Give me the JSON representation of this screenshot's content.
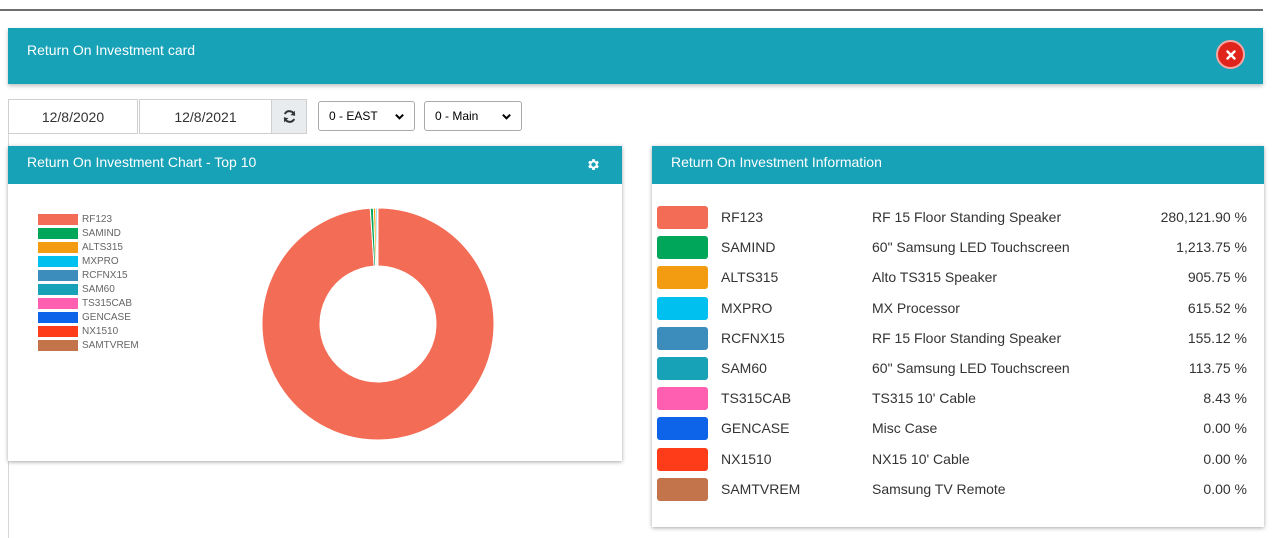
{
  "header": {
    "title": "Return On Investment card"
  },
  "filters": {
    "start_date": "12/8/2020",
    "end_date": "12/8/2021",
    "region": "0 - EAST",
    "location": "0 - Main"
  },
  "chart_card": {
    "title": "Return On Investment Chart - Top 10"
  },
  "info_card": {
    "title": "Return On Investment Information"
  },
  "items": [
    {
      "code": "RF123",
      "description": "RF 15 Floor Standing Speaker",
      "roi": "280,121.90 %",
      "color": "#f36c55"
    },
    {
      "code": "SAMIND",
      "description": "60\" Samsung LED Touchscreen",
      "roi": "1,213.75 %",
      "color": "#00a65a"
    },
    {
      "code": "ALTS315",
      "description": "Alto TS315 Speaker",
      "roi": "905.75 %",
      "color": "#f39c12"
    },
    {
      "code": "MXPRO",
      "description": "MX Processor",
      "roi": "615.52 %",
      "color": "#00c0ef"
    },
    {
      "code": "RCFNX15",
      "description": "RF 15 Floor Standing Speaker",
      "roi": "155.12 %",
      "color": "#3c8dbc"
    },
    {
      "code": "SAM60",
      "description": "60\" Samsung LED Touchscreen",
      "roi": "113.75 %",
      "color": "#17a2b8"
    },
    {
      "code": "TS315CAB",
      "description": "TS315 10' Cable",
      "roi": "8.43 %",
      "color": "#ff5fb0"
    },
    {
      "code": "GENCASE",
      "description": "Misc Case",
      "roi": "0.00 %",
      "color": "#0d64e8"
    },
    {
      "code": "NX1510",
      "description": "NX15 10' Cable",
      "roi": "0.00 %",
      "color": "#ff3c1a"
    },
    {
      "code": "SAMTVREM",
      "description": "Samsung TV Remote",
      "roi": "0.00 %",
      "color": "#c4744a"
    }
  ],
  "chart_data": {
    "type": "pie",
    "donut": true,
    "legend_position": "left",
    "categories": [
      "RF123",
      "SAMIND",
      "ALTS315",
      "MXPRO",
      "RCFNX15",
      "SAM60",
      "TS315CAB",
      "GENCASE",
      "NX1510",
      "SAMTVREM"
    ],
    "values": [
      280121.9,
      1213.75,
      905.75,
      615.52,
      155.12,
      113.75,
      8.43,
      0.0,
      0.0,
      0.0
    ],
    "colors": [
      "#f36c55",
      "#00a65a",
      "#f39c12",
      "#00c0ef",
      "#3c8dbc",
      "#17a2b8",
      "#ff5fb0",
      "#0d64e8",
      "#ff3c1a",
      "#c4744a"
    ]
  }
}
